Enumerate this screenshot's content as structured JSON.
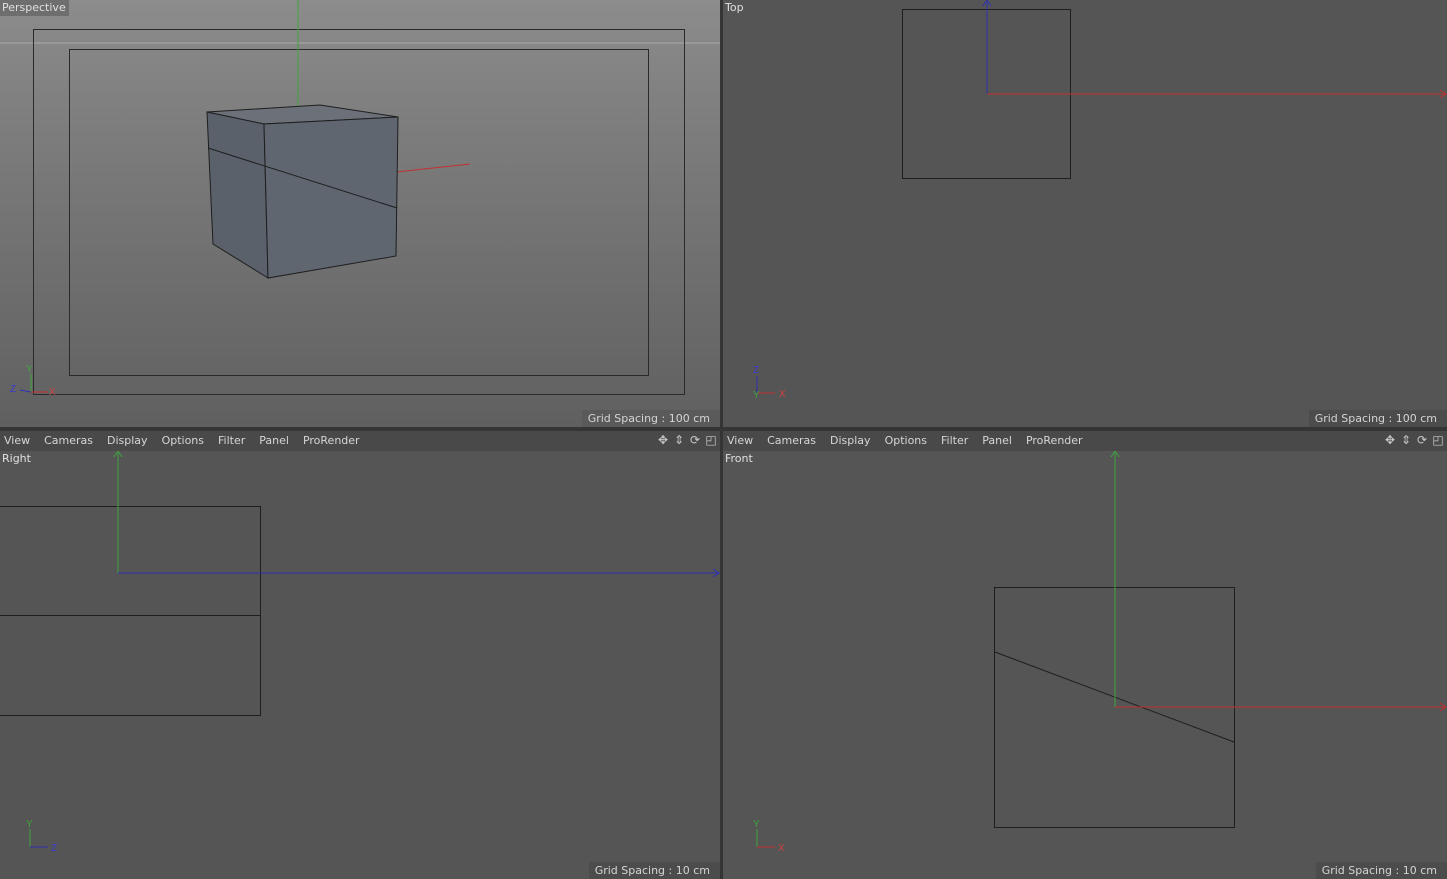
{
  "viewports": {
    "perspective": {
      "label": "Perspective",
      "grid": "Grid Spacing : 100 cm",
      "axes": [
        "Y",
        "Z",
        "X"
      ]
    },
    "top": {
      "label": "Top",
      "grid": "Grid Spacing : 100 cm",
      "axes": [
        "Z",
        "Y",
        "X"
      ]
    },
    "right": {
      "label": "Right",
      "grid": "Grid Spacing : 10 cm",
      "axes": [
        "Y",
        "Z"
      ]
    },
    "front": {
      "label": "Front",
      "grid": "Grid Spacing : 10 cm",
      "axes": [
        "Y",
        "X"
      ]
    }
  },
  "menu": {
    "view": "View",
    "cameras": "Cameras",
    "display": "Display",
    "options": "Options",
    "filter": "Filter",
    "panel": "Panel",
    "prorender": "ProRender"
  },
  "colors": {
    "axis_x": "#c03030",
    "axis_y": "#3aa03a",
    "axis_z": "#3030b0",
    "viewport_bg": "#555555",
    "cube_face": "#5f6670"
  },
  "icons": [
    "move-view-icon",
    "zoom-view-icon",
    "rotate-view-icon",
    "maximize-view-icon"
  ]
}
